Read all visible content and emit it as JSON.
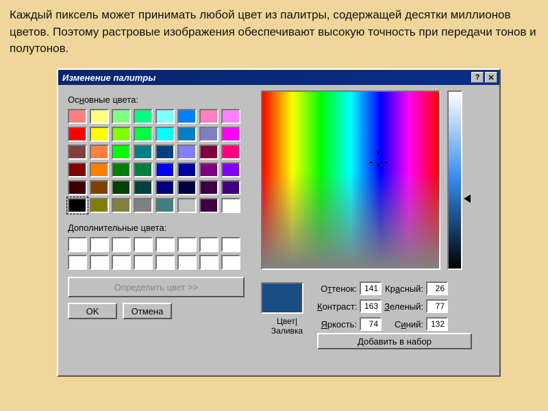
{
  "caption_text": "Каждый пиксель может принимать любой цвет из палитры, содержащей десятки миллионов цветов. Поэтому растровые изображения обеспечивают высокую точность при передачи тонов и полутонов.",
  "dialog": {
    "title": "Изменение палитры",
    "help_btn": "?",
    "close_btn": "✕",
    "basic_label": "Основные цвета:",
    "custom_label": "Дополнительные цвета:",
    "define_btn": "Определить цвет >>",
    "ok_btn": "OK",
    "cancel_btn": "Отмена",
    "preview_label": "Цвет|Заливка",
    "hue_label": "Оттенок:",
    "sat_label": "Контраст:",
    "lum_label": "Яркость:",
    "red_label": "Красный:",
    "green_label": "Зеленый:",
    "blue_label": "Синий:",
    "hue_val": "141",
    "sat_val": "163",
    "lum_val": "74",
    "red_val": "26",
    "green_val": "77",
    "blue_val": "132",
    "add_btn": "Добавить в набор",
    "basic_colors": [
      "#ff8080",
      "#ffff80",
      "#80ff80",
      "#00ff80",
      "#80ffff",
      "#0080ff",
      "#ff80c0",
      "#ff80ff",
      "#ff0000",
      "#ffff00",
      "#80ff00",
      "#00ff40",
      "#00ffff",
      "#0080c0",
      "#8080c0",
      "#ff00ff",
      "#804040",
      "#ff8040",
      "#00ff00",
      "#008080",
      "#004080",
      "#8080ff",
      "#800040",
      "#ff0080",
      "#800000",
      "#ff8000",
      "#008000",
      "#008040",
      "#0000ff",
      "#0000a0",
      "#800080",
      "#8000ff",
      "#400000",
      "#804000",
      "#004000",
      "#004040",
      "#000080",
      "#000040",
      "#400040",
      "#400080",
      "#000000",
      "#808000",
      "#808040",
      "#808080",
      "#408080",
      "#c0c0c0",
      "#400040",
      "#ffffff"
    ],
    "selected_basic": 40,
    "custom_slots": 16,
    "preview_color": "#1a4d84"
  }
}
